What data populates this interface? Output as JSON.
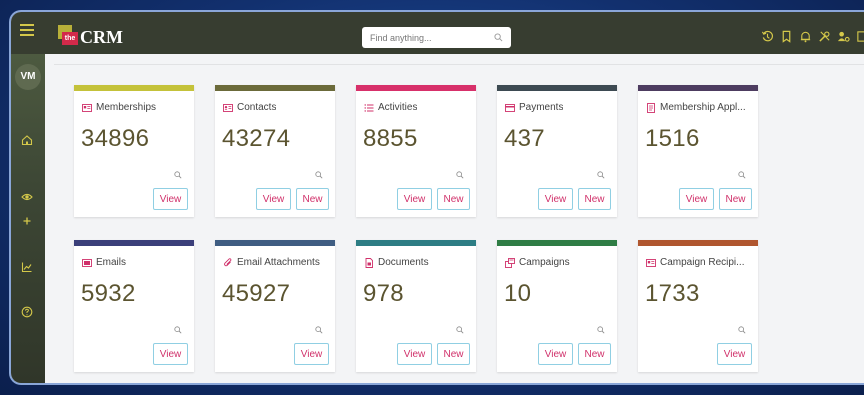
{
  "app": {
    "logo_small": "the",
    "logo_text": "CRM",
    "user_initials": "VM",
    "search_placeholder": "Find anything..."
  },
  "colors": {
    "memberships": "#c4c23a",
    "contacts": "#6b6a3a",
    "activities": "#d7306a",
    "payments": "#3d4a52",
    "membership_applications": "#4d3c60",
    "emails": "#3b3f7a",
    "email_attachments": "#3f5d82",
    "documents": "#2d7d84",
    "campaigns": "#2f7d45",
    "campaign_recipients": "#b0562f"
  },
  "cards": [
    {
      "id": "memberships",
      "title": "Memberships",
      "count": "34896",
      "icon": "id-card-icon",
      "view": "View",
      "new": ""
    },
    {
      "id": "contacts",
      "title": "Contacts",
      "count": "43274",
      "icon": "contact-card-icon",
      "view": "View",
      "new": "New"
    },
    {
      "id": "activities",
      "title": "Activities",
      "count": "8855",
      "icon": "list-icon",
      "view": "View",
      "new": "New"
    },
    {
      "id": "payments",
      "title": "Payments",
      "count": "437",
      "icon": "credit-card-icon",
      "view": "View",
      "new": "New"
    },
    {
      "id": "membership_applications",
      "title": "Membership Appl...",
      "count": "1516",
      "icon": "form-icon",
      "view": "View",
      "new": "New"
    },
    {
      "id": "emails",
      "title": "Emails",
      "count": "5932",
      "icon": "email-icon",
      "view": "View",
      "new": ""
    },
    {
      "id": "email_attachments",
      "title": "Email Attachments",
      "count": "45927",
      "icon": "paperclip-icon",
      "view": "View",
      "new": ""
    },
    {
      "id": "documents",
      "title": "Documents",
      "count": "978",
      "icon": "document-icon",
      "view": "View",
      "new": "New"
    },
    {
      "id": "campaigns",
      "title": "Campaigns",
      "count": "10",
      "icon": "campaign-icon",
      "view": "View",
      "new": "New"
    },
    {
      "id": "campaign_recipients",
      "title": "Campaign Recipi...",
      "count": "1733",
      "icon": "recipient-card-icon",
      "view": "View",
      "new": ""
    }
  ]
}
